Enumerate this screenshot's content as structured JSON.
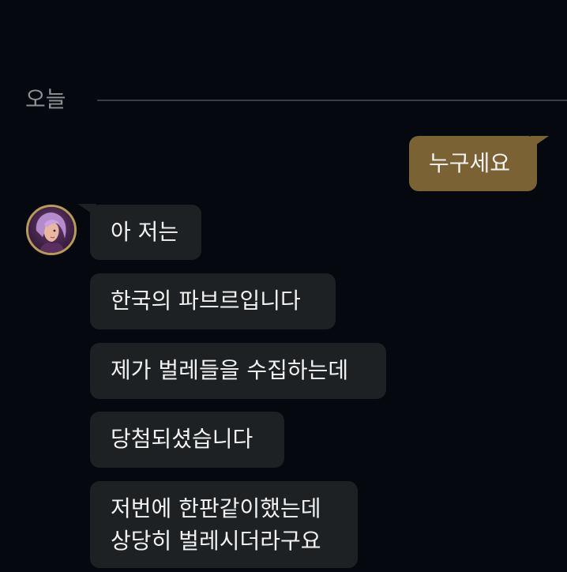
{
  "date_divider": {
    "label": "오늘"
  },
  "messages": {
    "sent": [
      {
        "text": "누구세요"
      }
    ],
    "received": [
      {
        "text": "아 저는"
      },
      {
        "text": "한국의 파브르입니다"
      },
      {
        "text": "제가 벌레들을 수집하는데"
      },
      {
        "text": "당첨되셨습니다"
      },
      {
        "text": "저번에 한판같이했는데\n상당히 벌레시더라구요"
      }
    ]
  },
  "sender": {
    "avatar_icon": "champion-portrait-icon"
  },
  "colors": {
    "background": "#05090f",
    "sent_bubble": "#7a6235",
    "received_bubble": "#1d2124",
    "avatar_border": "#b89a5a",
    "divider": "#3b3e42",
    "date_text": "#8e9194"
  }
}
